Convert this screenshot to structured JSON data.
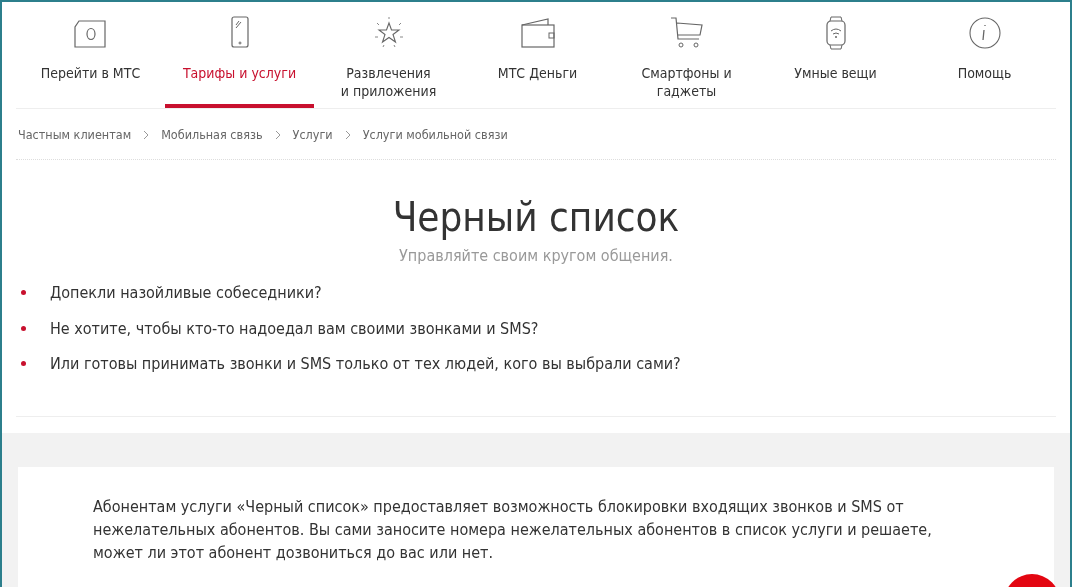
{
  "nav": [
    {
      "label": "Перейти в МТС",
      "selected": false
    },
    {
      "label": "Тарифы и услуги",
      "selected": true
    },
    {
      "label": "Развлечения\nи приложения",
      "selected": false
    },
    {
      "label": "МТС Деньги",
      "selected": false
    },
    {
      "label": "Смартфоны и\nгаджеты",
      "selected": false
    },
    {
      "label": "Умные вещи",
      "selected": false
    },
    {
      "label": "Помощь",
      "selected": false
    }
  ],
  "breadcrumbs": [
    "Частным клиентам",
    "Мобильная связь",
    "Услуги",
    "Услуги мобильной связи"
  ],
  "title": "Черный список",
  "subtitle": "Управляйте своим кругом общения.",
  "bullets": [
    "Допекли назойливые собеседники?",
    "Не хотите, чтобы кто-то надоедал вам своими звонками и SMS?",
    "Или готовы принимать звонки и SMS только от тех людей, кого вы выбрали сами?"
  ],
  "description": "Абонентам услуги «Черный список» предоставляет возможность блокировки входящих звонков и SMS от нежелательных абонентов. Вы сами заносите номера нежелательных абонентов в список услуги и решаете, может ли этот абонент дозвониться до вас или нет."
}
